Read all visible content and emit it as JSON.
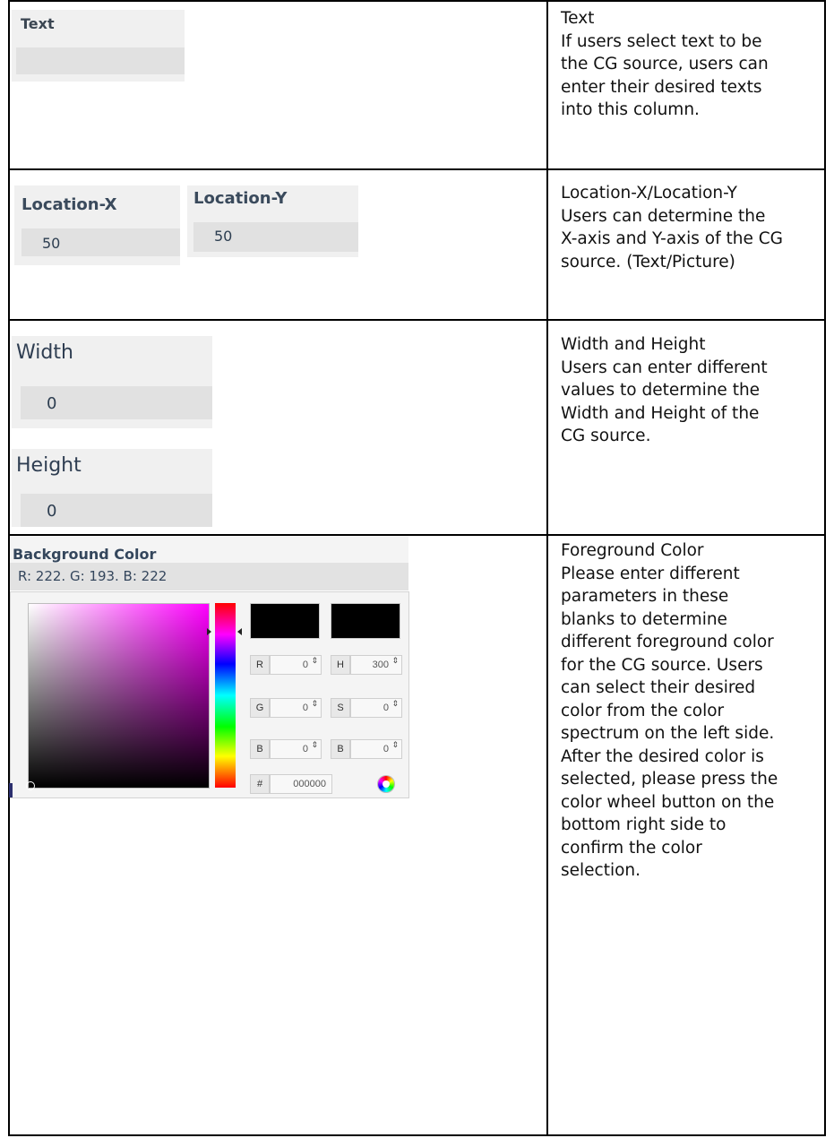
{
  "rows": [
    {
      "widget": {
        "label": "Text",
        "value": ""
      },
      "description": {
        "title": "Text",
        "lines": [
          "If users select text to be",
          "the CG source, users can",
          "enter their desired texts",
          "into this column."
        ]
      }
    },
    {
      "widgets": [
        {
          "label": "Location-X",
          "value": "50"
        },
        {
          "label": "Location-Y",
          "value": "50"
        }
      ],
      "description": {
        "title": "Location-X/Location-Y",
        "lines": [
          "Users can determine the",
          "X-axis and Y-axis of the CG",
          "source. (Text/Picture)"
        ]
      }
    },
    {
      "widgets": [
        {
          "label": "Width",
          "value": "0"
        },
        {
          "label": "Height",
          "value": "0"
        }
      ],
      "description": {
        "title": "Width and Height",
        "lines": [
          "Users can enter different",
          "values to determine the",
          "Width and Height of the",
          "CG source."
        ]
      }
    },
    {
      "picker": {
        "label": "Background Color",
        "rgb_readout": "R: 222. G: 193. B: 222",
        "spectrum_hue_color": "#ff00ff",
        "new_color": "#000000",
        "current_color": "#000000",
        "fields": {
          "r": {
            "label": "R",
            "value": "0"
          },
          "g": {
            "label": "G",
            "value": "0"
          },
          "b": {
            "label": "B",
            "value": "0"
          },
          "h": {
            "label": "H",
            "value": "300"
          },
          "s": {
            "label": "S",
            "value": "0"
          },
          "bv": {
            "label": "B",
            "value": "0"
          },
          "hex": {
            "label": "#",
            "value": "000000"
          }
        },
        "submit_icon": "color-wheel-icon",
        "spin_arrows": "⇕"
      },
      "description": {
        "title": "Foreground Color",
        "lines": [
          "Please enter different",
          "parameters in these",
          "blanks to determine",
          "different foreground color",
          "for the CG source. Users",
          "can select their desired",
          "color from the color",
          "spectrum on the left side.",
          "After the desired color is",
          "selected, please press the",
          "color wheel button on the",
          "bottom right side to",
          "confirm the color",
          "selection."
        ]
      }
    }
  ]
}
